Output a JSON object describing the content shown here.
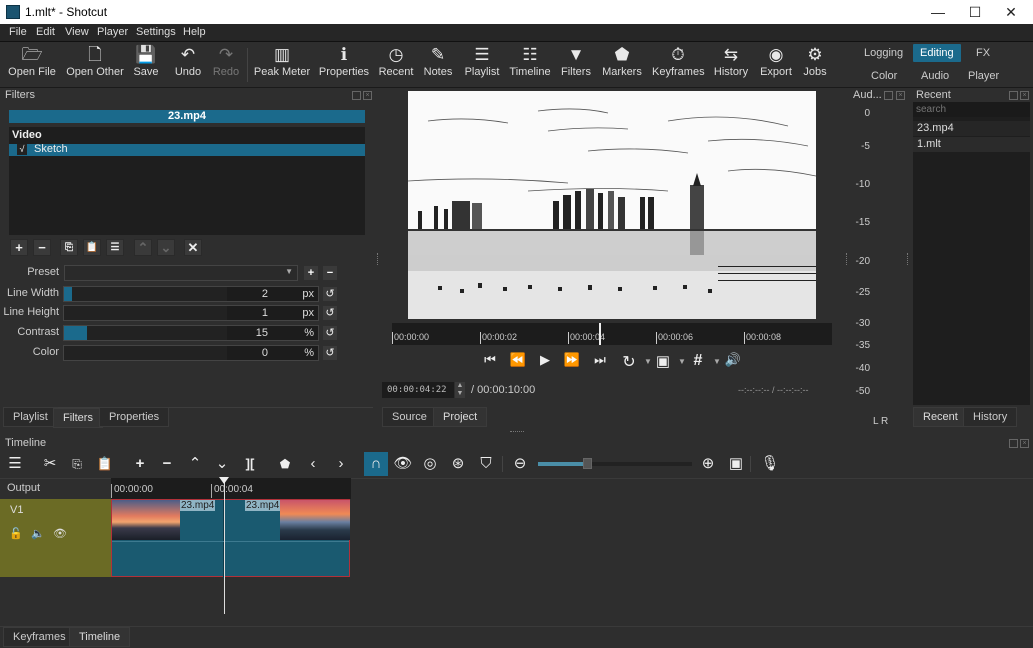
{
  "window": {
    "title": "1.mlt* - Shotcut",
    "minimize": "—",
    "maximize": "☐",
    "close": "✕"
  },
  "menu": [
    "File",
    "Edit",
    "View",
    "Player",
    "Settings",
    "Help"
  ],
  "toolbar": [
    {
      "label": "Open File",
      "icon": "folder-open-icon",
      "glyph": "🗁",
      "enabled": true
    },
    {
      "label": "Open Other",
      "icon": "file-plus-icon",
      "glyph": "🗋",
      "enabled": true
    },
    {
      "label": "Save",
      "icon": "save-icon",
      "glyph": "💾",
      "enabled": true
    },
    {
      "label": "Undo",
      "icon": "undo-icon",
      "glyph": "↶",
      "enabled": true
    },
    {
      "label": "Redo",
      "icon": "redo-icon",
      "glyph": "↷",
      "enabled": false
    },
    {
      "label": "Peak Meter",
      "icon": "peak-meter-icon",
      "glyph": "▥",
      "enabled": true
    },
    {
      "label": "Properties",
      "icon": "info-icon",
      "glyph": "ℹ",
      "enabled": true
    },
    {
      "label": "Recent",
      "icon": "clock-icon",
      "glyph": "◷",
      "enabled": true
    },
    {
      "label": "Notes",
      "icon": "notes-icon",
      "glyph": "✎",
      "enabled": true
    },
    {
      "label": "Playlist",
      "icon": "playlist-icon",
      "glyph": "☰",
      "enabled": true
    },
    {
      "label": "Timeline",
      "icon": "timeline-icon",
      "glyph": "☷",
      "enabled": true
    },
    {
      "label": "Filters",
      "icon": "filter-icon",
      "glyph": "▼",
      "enabled": true
    },
    {
      "label": "Markers",
      "icon": "marker-icon",
      "glyph": "⬟",
      "enabled": true
    },
    {
      "label": "Keyframes",
      "icon": "stopwatch-icon",
      "glyph": "⏱",
      "enabled": true
    },
    {
      "label": "History",
      "icon": "history-icon",
      "glyph": "⇆",
      "enabled": true
    },
    {
      "label": "Export",
      "icon": "export-disc-icon",
      "glyph": "◉",
      "enabled": true
    },
    {
      "label": "Jobs",
      "icon": "gear-icon",
      "glyph": "⚙",
      "enabled": true
    }
  ],
  "layouts": {
    "row1": [
      "Logging",
      "Editing",
      "FX"
    ],
    "row2": [
      "Color",
      "Audio",
      "Player"
    ],
    "active": "Editing"
  },
  "filters": {
    "title": "Filters",
    "clip": "23.mp4",
    "category": "Video",
    "items": [
      {
        "name": "Sketch",
        "checked": true,
        "check_glyph": "√"
      }
    ],
    "buttons": [
      "+",
      "−",
      "⎘",
      "📋",
      "☰",
      "⌃",
      "⌄",
      "✕"
    ],
    "preset_label": "Preset",
    "preset_value": "",
    "params": [
      {
        "label": "Line Width",
        "value": "2",
        "unit": "px",
        "fraction": 0.03
      },
      {
        "label": "Line Height",
        "value": "1",
        "unit": "px",
        "fraction": 0.0
      },
      {
        "label": "Contrast",
        "value": "15",
        "unit": "%",
        "fraction": 0.09
      },
      {
        "label": "Color",
        "value": "0",
        "unit": "%",
        "fraction": 0.0
      }
    ],
    "reset_glyph": "↺"
  },
  "left_tabs": [
    "Playlist",
    "Filters",
    "Properties"
  ],
  "left_tab_active": "Filters",
  "player": {
    "ruler": [
      "00:00:00",
      "00:00:02",
      "00:00:04",
      "00:00:06",
      "00:00:08"
    ],
    "position_fraction": 0.47,
    "current_time": "00:00:04:22",
    "total_time": "/ 00:00:10:00",
    "in_out": "--:--:--:-- /  --:--:--:--",
    "controls": [
      {
        "name": "skip-to-start",
        "glyph": "⏮"
      },
      {
        "name": "rewind",
        "glyph": "⏪"
      },
      {
        "name": "play",
        "glyph": "▶"
      },
      {
        "name": "fast-forward",
        "glyph": "⏩"
      },
      {
        "name": "skip-to-end",
        "glyph": "⏭"
      },
      {
        "name": "loop",
        "glyph": "↻"
      },
      {
        "name": "zoom-fit",
        "glyph": "▣"
      },
      {
        "name": "grid",
        "glyph": "#"
      },
      {
        "name": "volume",
        "glyph": "🔊"
      }
    ],
    "tabs": [
      "Source",
      "Project"
    ],
    "tab_active": "Project"
  },
  "audio_meter": {
    "title": "Aud...",
    "scale": [
      "0",
      "-5",
      "-10",
      "-15",
      "-20",
      "-25",
      "-30",
      "-35",
      "-40",
      "-50"
    ],
    "channels": "L  R"
  },
  "recent": {
    "title": "Recent",
    "search_placeholder": "search",
    "items": [
      "23.mp4",
      "1.mlt"
    ],
    "tabs": [
      "Recent",
      "History"
    ],
    "tab_active": "Recent"
  },
  "timeline": {
    "title": "Timeline",
    "output_label": "Output",
    "ruler": [
      "00:00:00",
      "00:00:04"
    ],
    "track": {
      "name": "V1",
      "lock_glyph": "🔓",
      "mute_glyph": "🔈",
      "hide_glyph": "👁"
    },
    "clips": [
      {
        "label": "23.mp4"
      },
      {
        "label": "23.mp4"
      }
    ],
    "zoom_fraction": 0.32,
    "playhead_fraction": 0.47
  },
  "bottom_tabs": [
    "Keyframes",
    "Timeline"
  ],
  "bottom_tab_active": "Timeline",
  "colors": {
    "accent": "#1b6a8c",
    "track_header": "#6b6b25",
    "clip_border": "#b2313a",
    "clip_bg": "#1a5a70"
  }
}
